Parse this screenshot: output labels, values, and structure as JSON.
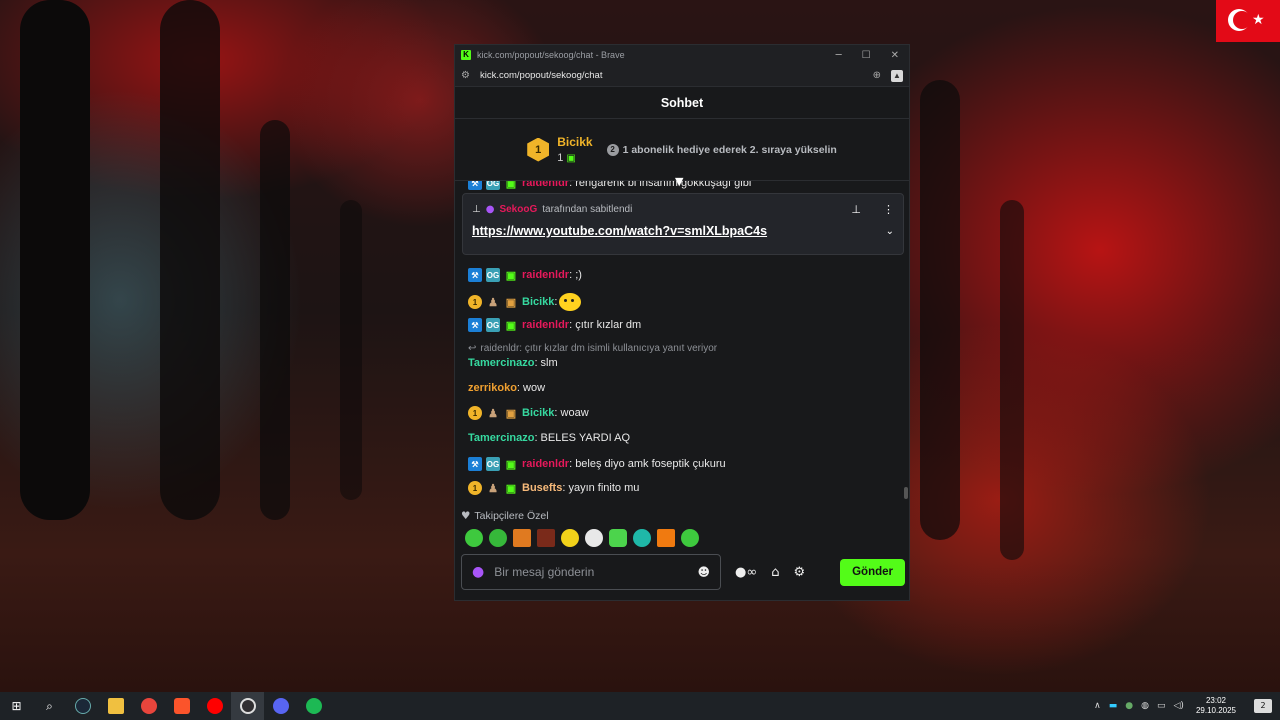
{
  "browser": {
    "title": "kick.com/popout/sekoog/chat - Brave",
    "url": "kick.com/popout/sekoog/chat",
    "kick_logo": "K"
  },
  "chat": {
    "header": "Sohbet",
    "leaderboard": {
      "rank": "1",
      "name": "Bicikk",
      "count": "1",
      "next_rank": "2",
      "prompt": "1 abonelik hediye ederek 2. sıraya yükselin"
    },
    "pinned": {
      "pinned_by": "SekooG",
      "pinned_suffix": "tarafından sabitlendi",
      "link": "https://www.youtube.com/watch?v=smlXLbpaC4s"
    },
    "partial_top": {
      "user": "raidenldr",
      "text": ": rengarenk bi insanım gökkuşağı gibi"
    },
    "messages": [
      {
        "badges": [
          "mod",
          "og",
          "sub"
        ],
        "user": "raidenldr",
        "color": "red",
        "text": ": ;)"
      },
      {
        "badges": [
          "gold",
          "person",
          "box"
        ],
        "user": "Bicikk",
        "color": "green",
        "text": ":",
        "emote": true
      },
      {
        "badges": [
          "mod",
          "og",
          "sub"
        ],
        "user": "raidenldr",
        "color": "red",
        "text": ": çıtır kızlar dm"
      },
      {
        "reply": "raidenldr: çıtır kızlar dm isimli kullanıcıya yanıt veriyor"
      },
      {
        "badges": [],
        "user": "Tamercinazo",
        "color": "green",
        "text": ": slm"
      },
      {
        "badges": [],
        "user": "zerrikoko",
        "color": "orange",
        "text": ": wow"
      },
      {
        "badges": [
          "gold",
          "person",
          "box"
        ],
        "user": "Bicikk",
        "color": "green",
        "text": ": woaw"
      },
      {
        "badges": [],
        "user": "Tamercinazo",
        "color": "green",
        "text": ": BELES YARDI AQ"
      },
      {
        "badges": [
          "mod",
          "og",
          "sub"
        ],
        "user": "raidenldr",
        "color": "red",
        "text": ": beleş diyo amk foseptik çukuru"
      },
      {
        "badges": [
          "gold",
          "person",
          "sub"
        ],
        "user": "Busefts",
        "color": "peach",
        "text": ": yayın finito mu"
      }
    ],
    "followers_label": "Takipçilere Özel",
    "input_placeholder": "Bir mesaj gönderin",
    "send_label": "Gönder"
  },
  "taskbar": {
    "time": "23:02",
    "date": "29.10.2025",
    "notifications": "2"
  },
  "colors": {
    "kick_green": "#53fc18",
    "username_red": "#e6195b",
    "username_green": "#36d9a0",
    "username_orange": "#f0a030",
    "username_peach": "#f6b97a",
    "gold": "#f0b429"
  }
}
